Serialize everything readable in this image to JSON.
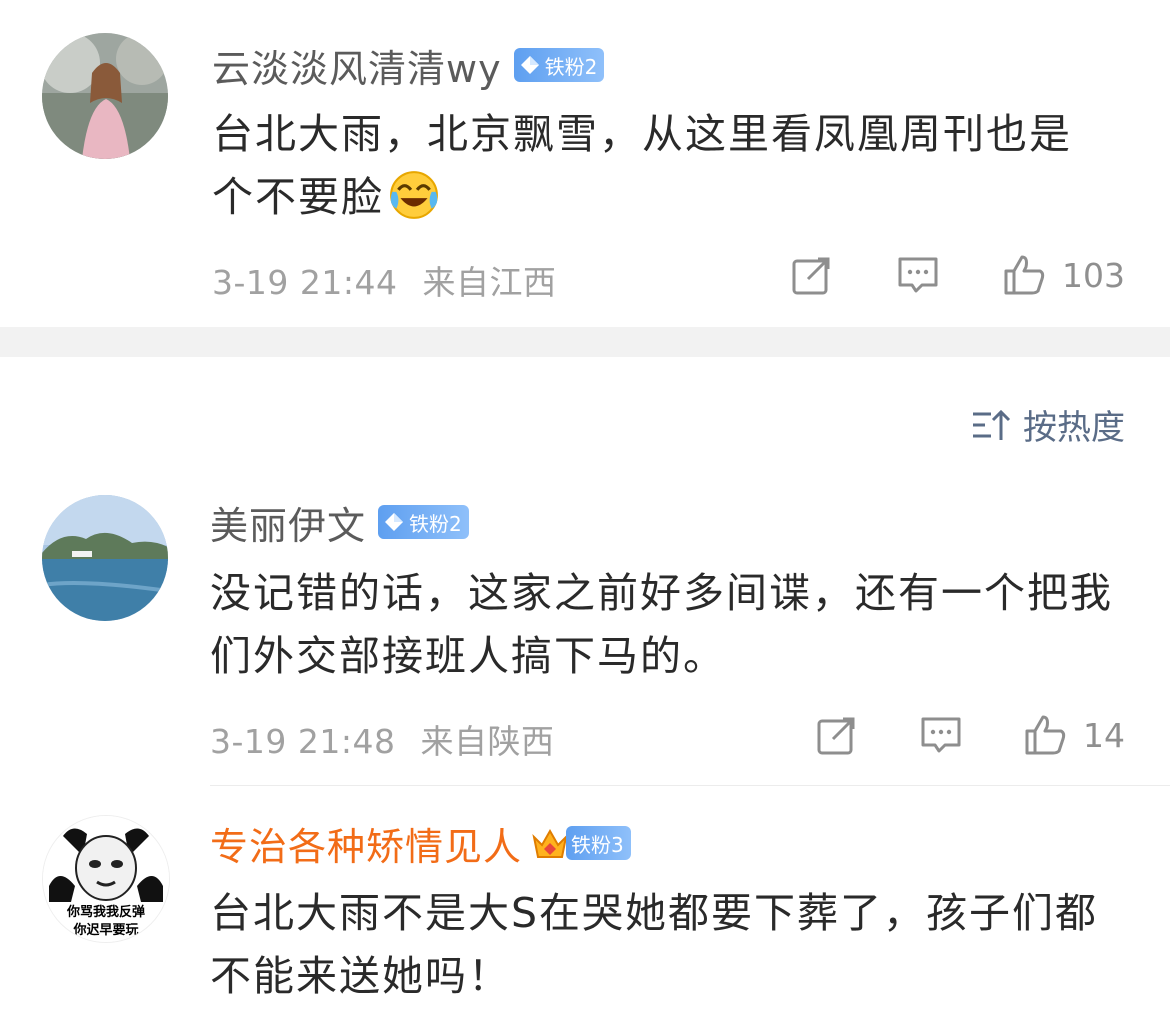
{
  "pinned_comment": {
    "username": "云淡淡风清清wy",
    "badge": "铁粉2",
    "text": "台北大雨，北京飘雪，从这里看凤凰周刊也是个不要脸",
    "emoji": "laugh-cry-emoji",
    "date": "3-19 21:44",
    "location": "来自江西",
    "likes": "103"
  },
  "sort": {
    "label": "按热度",
    "icon": "sort-icon"
  },
  "comments": [
    {
      "username": "美丽伊文",
      "badge": "铁粉2",
      "text": "没记错的话，这家之前好多间谍，还有一个把我们外交部接班人搞下马的。",
      "date": "3-19 21:48",
      "location": "来自陕西",
      "likes": "14"
    },
    {
      "username": "专治各种矫情见人",
      "badge": "铁粉3",
      "text": "台北大雨不是大S在哭她都要下葬了，孩子们都不能来送她吗！",
      "avatar_text_1": "你骂我我反弹",
      "avatar_text_2": "你迟早要玩"
    }
  ],
  "colors": {
    "vip_name": "#f26c17",
    "badge_blue": "#6aa8f5",
    "meta_gray": "#a1a1a1",
    "sort_blue": "#5a6c87"
  }
}
